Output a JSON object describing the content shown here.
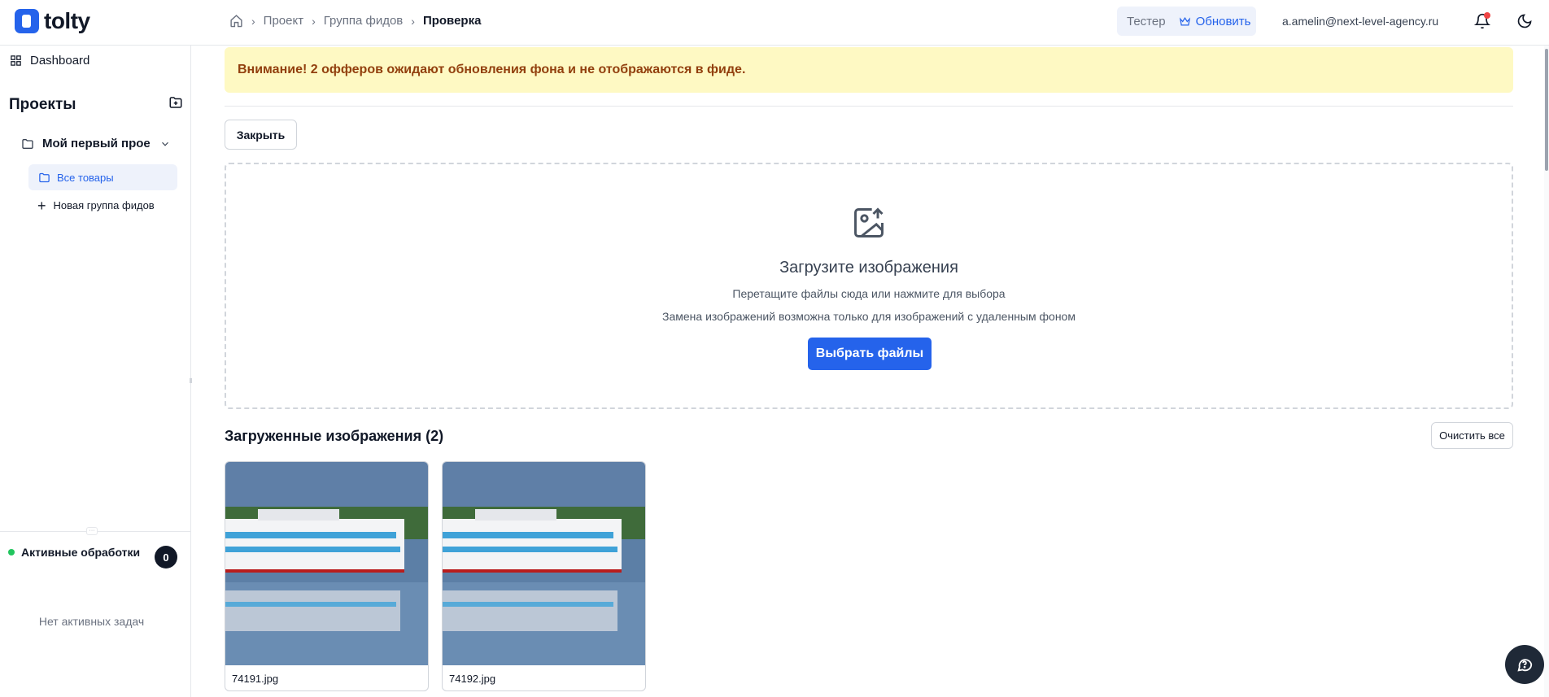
{
  "header": {
    "logo_text": "tolty",
    "breadcrumb": [
      "Проект",
      "Группа фидов",
      "Проверка"
    ],
    "plan_name": "Тестер",
    "upgrade_label": "Обновить",
    "user_email": "a.amelin@next-level-agency.ru",
    "icons": [
      "home-icon",
      "crown-icon",
      "bell-icon",
      "moon-icon"
    ],
    "accent": "#2563eb"
  },
  "sidebar": {
    "dashboard_label": "Dashboard",
    "projects_title": "Проекты",
    "project_name": "Мой первый проект",
    "active_group": "Все товары",
    "new_group_label": "Новая группа фидов",
    "active_processing_label": "Активные обработки",
    "active_processing_count": "0",
    "no_tasks_label": "Нет активных задач"
  },
  "main": {
    "alert_text": "Внимание! 2 офферов ожидают обновления фона и не отображаются в фиде.",
    "close_label": "Закрыть",
    "dropzone": {
      "title": "Загрузите изображения",
      "subtitle": "Перетащите файлы сюда или нажмите для выбора",
      "note": "Замена изображений возможна только для изображений с удаленным фоном",
      "button": "Выбрать файлы"
    },
    "uploaded_title": "Загруженные изображения (2)",
    "clear_all_label": "Очистить все",
    "images": [
      {
        "filename": "74191.jpg"
      },
      {
        "filename": "74192.jpg"
      }
    ]
  }
}
